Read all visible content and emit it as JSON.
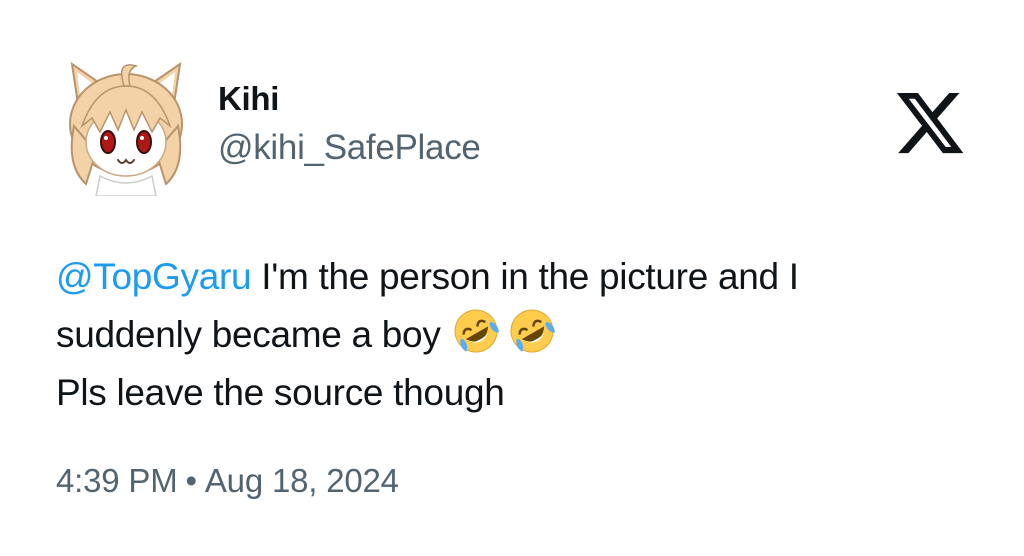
{
  "author": {
    "display_name": "Kihi",
    "handle": "@kihi_SafePlace",
    "avatar_icon": "anime-cat-girl-avatar"
  },
  "platform": {
    "logo_icon": "x-logo-icon"
  },
  "tweet": {
    "mention": "@TopGyaru",
    "line1_rest": " I'm the person in the picture and I",
    "line2": "suddenly became a boy",
    "line2_emoji": [
      "rolling-on-floor-laughing-emoji",
      "rolling-on-floor-laughing-emoji"
    ],
    "line3": "Pls leave the source though"
  },
  "meta": {
    "time": "4:39 PM",
    "separator": "•",
    "date": "Aug 18, 2024"
  },
  "colors": {
    "text": "#0f1419",
    "secondary": "#536471",
    "mention": "#1d9bf0"
  }
}
